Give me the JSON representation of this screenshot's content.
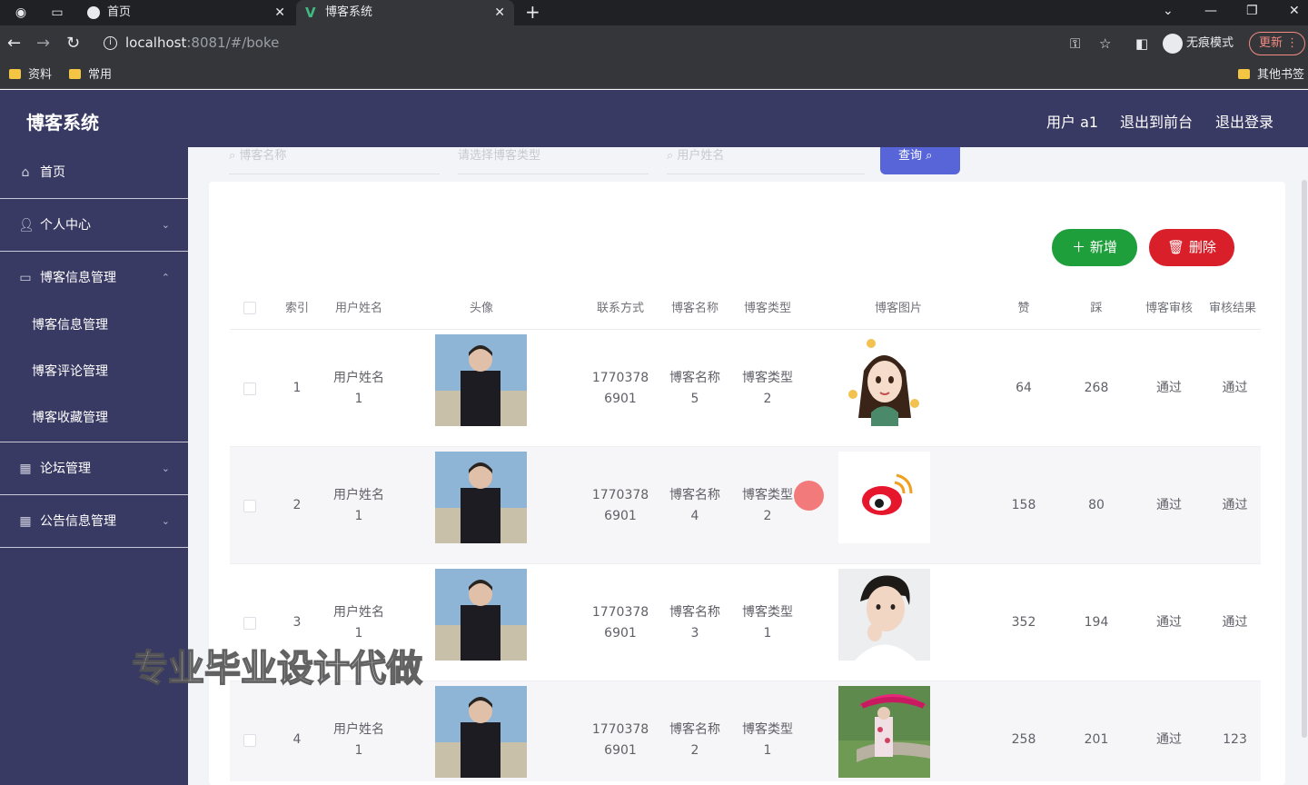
{
  "browser": {
    "tabs": [
      {
        "label": "首页",
        "active": false
      },
      {
        "label": "博客系统",
        "active": true
      }
    ],
    "url_host": "localhost",
    "url_rest": ":8081/#/boke",
    "incognito_label": "无痕模式",
    "update_label": "更新",
    "bookmarks": [
      "资料",
      "常用"
    ],
    "other_bookmarks": "其他书签"
  },
  "header": {
    "title": "博客系统",
    "user_label": "用户 a1",
    "back_front_label": "退出到前台",
    "logout_label": "退出登录"
  },
  "sidebar": {
    "items": [
      {
        "label": "首页",
        "icon": "home-icon"
      },
      {
        "label": "个人中心",
        "icon": "user-icon"
      },
      {
        "label": "博客信息管理",
        "icon": "message-icon"
      },
      {
        "label": "论坛管理",
        "icon": "calendar-icon"
      },
      {
        "label": "公告信息管理",
        "icon": "grid-icon"
      }
    ],
    "submenu": [
      "博客信息管理",
      "博客评论管理",
      "博客收藏管理"
    ]
  },
  "search": {
    "placeholder_name": "博客名称",
    "placeholder_type": "请选择博客类型",
    "placeholder_user": "用户姓名",
    "query_label": "查询"
  },
  "actions": {
    "add_label": "新增",
    "delete_label": "删除"
  },
  "table": {
    "columns": [
      "索引",
      "用户姓名",
      "头像",
      "联系方式",
      "博客名称",
      "博客类型",
      "博客图片",
      "赞",
      "踩",
      "博客审核",
      "审核结果"
    ],
    "rows": [
      {
        "index": "1",
        "user_line1": "用户姓名",
        "user_line2": "1",
        "phone_line1": "1770378",
        "phone_line2": "6901",
        "name_line1": "博客名称",
        "name_line2": "5",
        "type_line1": "博客类型",
        "type_line2": "2",
        "image": "cartoon-girl",
        "likes": "64",
        "dislikes": "268",
        "review": "通过",
        "result": "通过"
      },
      {
        "index": "2",
        "user_line1": "用户姓名",
        "user_line2": "1",
        "phone_line1": "1770378",
        "phone_line2": "6901",
        "name_line1": "博客名称",
        "name_line2": "4",
        "type_line1": "博客类型",
        "type_line2": "2",
        "image": "weibo-logo",
        "likes": "158",
        "dislikes": "80",
        "review": "通过",
        "result": "通过"
      },
      {
        "index": "3",
        "user_line1": "用户姓名",
        "user_line2": "1",
        "phone_line1": "1770378",
        "phone_line2": "6901",
        "name_line1": "博客名称",
        "name_line2": "3",
        "type_line1": "博客类型",
        "type_line2": "1",
        "image": "young-man-portrait",
        "likes": "352",
        "dislikes": "194",
        "review": "通过",
        "result": "通过"
      },
      {
        "index": "4",
        "user_line1": "用户姓名",
        "user_line2": "1",
        "phone_line1": "1770378",
        "phone_line2": "6901",
        "name_line1": "博客名称",
        "name_line2": "2",
        "type_line1": "博客类型",
        "type_line2": "1",
        "image": "girl-with-umbrella",
        "likes": "258",
        "dislikes": "201",
        "review": "通过",
        "result": "123"
      }
    ]
  },
  "watermark": "专业毕业设计代做",
  "colors": {
    "sidebar_bg": "#393a63",
    "add_button": "#1f9f3b",
    "delete_button": "#d9202a",
    "query_button": "#5865d8"
  }
}
